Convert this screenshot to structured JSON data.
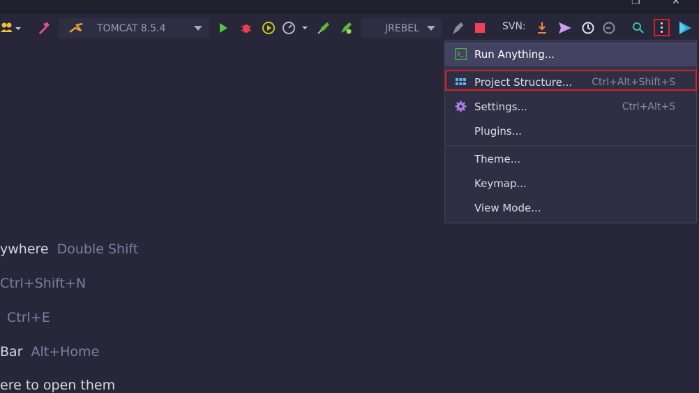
{
  "toolbar": {
    "run_config": "TOMCAT 8.5.4",
    "jrebel_config": "JREBEL",
    "svn_label": "SVN:"
  },
  "menu": {
    "items": [
      {
        "label": "Run Anything...",
        "shortcut": "",
        "icon": "terminal-icon"
      },
      {
        "label": "Project Structure...",
        "shortcut": "Ctrl+Alt+Shift+S",
        "icon": "grid-icon"
      },
      {
        "label": "Settings...",
        "shortcut": "Ctrl+Alt+S",
        "icon": "gear-icon"
      },
      {
        "label": "Plugins...",
        "shortcut": ""
      },
      {
        "label": "Theme...",
        "shortcut": ""
      },
      {
        "label": "Keymap...",
        "shortcut": ""
      },
      {
        "label": "View Mode...",
        "shortcut": ""
      }
    ]
  },
  "hints": [
    {
      "action": "ywhere",
      "key": "Double Shift"
    },
    {
      "action": "Ctrl+Shift+N",
      "key": ""
    },
    {
      "action": "",
      "key": "Ctrl+E"
    },
    {
      "action": "Bar",
      "key": "Alt+Home"
    },
    {
      "action": "ere to open them",
      "key": ""
    }
  ],
  "colors": {
    "background": "#272739",
    "menu_background": "#2f2f44",
    "selected_item": "#434361",
    "highlight_red": "#d8202a",
    "key_text": "#7c7fa3"
  }
}
